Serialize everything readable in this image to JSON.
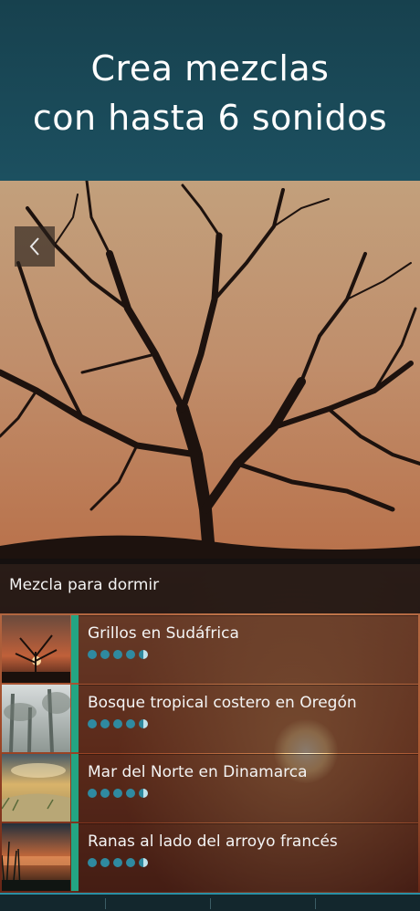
{
  "header": {
    "line1": "Crea mezclas",
    "line2": "con hasta 6 sonidos"
  },
  "mix": {
    "title": "Mezcla para dormir",
    "items": [
      {
        "label": "Grillos en Sudáfrica",
        "rating": 4.5
      },
      {
        "label": "Bosque tropical costero en Oregón",
        "rating": 4.5
      },
      {
        "label": "Mar del Norte en Dinamarca",
        "rating": 4.5
      },
      {
        "label": "Ranas al lado del arroyo francés",
        "rating": 4.5
      }
    ]
  },
  "icons": {
    "back": "chevron-left-icon"
  },
  "colors": {
    "header_bg": "#1c5060",
    "accent": "#23a583",
    "rating_dot": "#2f8aa0"
  }
}
